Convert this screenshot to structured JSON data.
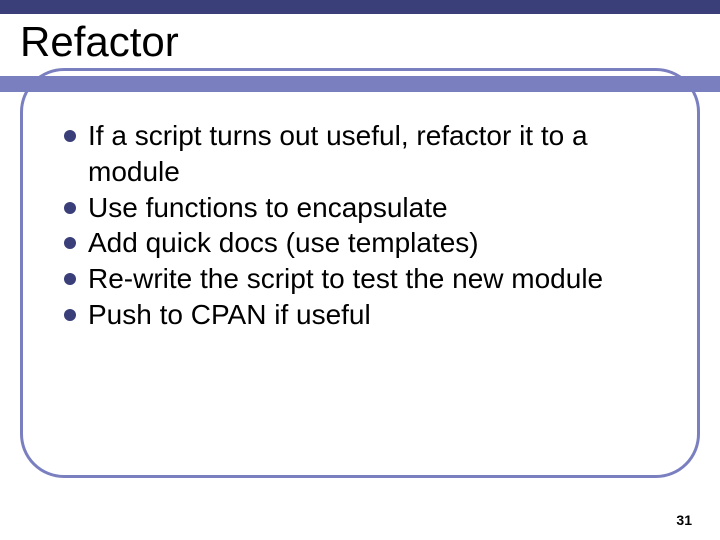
{
  "slide": {
    "title": "Refactor",
    "bullets": [
      "If a script turns out useful, refactor it to a module",
      "Use functions to encapsulate",
      "Add quick docs (use templates)",
      "Re-write the script to test the new module",
      "Push to CPAN if useful"
    ],
    "page_number": "31"
  },
  "colors": {
    "accent_dark": "#3a3f7a",
    "accent_light": "#7a7fc0"
  }
}
